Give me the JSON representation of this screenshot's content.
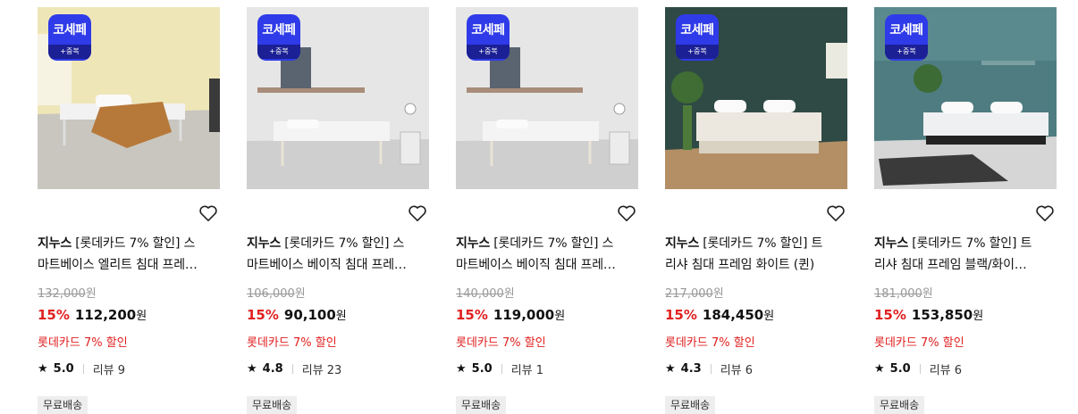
{
  "badge": {
    "top": "코세페",
    "bottom": "+중복"
  },
  "products": [
    {
      "brand": "지누스",
      "title_line1": " [롯데카드 7% 할인] 스",
      "title_line2": "마트베이스 엘리트 침대 프레…",
      "original_price": "132,000",
      "original_unit": "원",
      "discount": "15%",
      "price": "112,200",
      "price_unit": "원",
      "promo": "롯데카드 7% 할인",
      "rating": "5.0",
      "reviews": "리뷰 9",
      "shipping": "무료배송",
      "image": "white-metal-bed-frame-yellow-room"
    },
    {
      "brand": "지누스",
      "title_line1": " [롯데카드 7% 할인] 스",
      "title_line2": "마트베이스 베이직 침대 프레…",
      "original_price": "106,000",
      "original_unit": "원",
      "discount": "15%",
      "price": "90,100",
      "price_unit": "원",
      "promo": "롯데카드 7% 할인",
      "rating": "4.8",
      "reviews": "리뷰 23",
      "shipping": "무료배송",
      "image": "white-metal-bed-frame-shelf"
    },
    {
      "brand": "지누스",
      "title_line1": " [롯데카드 7% 할인] 스",
      "title_line2": "마트베이스 베이직 침대 프레…",
      "original_price": "140,000",
      "original_unit": "원",
      "discount": "15%",
      "price": "119,000",
      "price_unit": "원",
      "promo": "롯데카드 7% 할인",
      "rating": "5.0",
      "reviews": "리뷰 1",
      "shipping": "무료배송",
      "image": "white-metal-bed-frame-shelf"
    },
    {
      "brand": "지누스",
      "title_line1": " [롯데카드 7% 할인] 트",
      "title_line2": "리샤 침대 프레임 화이트 (퀸)",
      "original_price": "217,000",
      "original_unit": "원",
      "discount": "15%",
      "price": "184,450",
      "price_unit": "원",
      "promo": "롯데카드 7% 할인",
      "rating": "4.3",
      "reviews": "리뷰 6",
      "shipping": "무료배송",
      "image": "white-bed-frame-green-wall"
    },
    {
      "brand": "지누스",
      "title_line1": " [롯데카드 7% 할인] 트",
      "title_line2": "리샤 침대 프레임 블랙/화이…",
      "original_price": "181,000",
      "original_unit": "원",
      "discount": "15%",
      "price": "153,850",
      "price_unit": "원",
      "promo": "롯데카드 7% 할인",
      "rating": "5.0",
      "reviews": "리뷰 6",
      "shipping": "무료배송",
      "image": "black-bed-frame-teal-wall"
    }
  ],
  "colors": {
    "discount": "#e02020",
    "badge": "#2f3be8",
    "badge_bottom": "#1b2095"
  }
}
